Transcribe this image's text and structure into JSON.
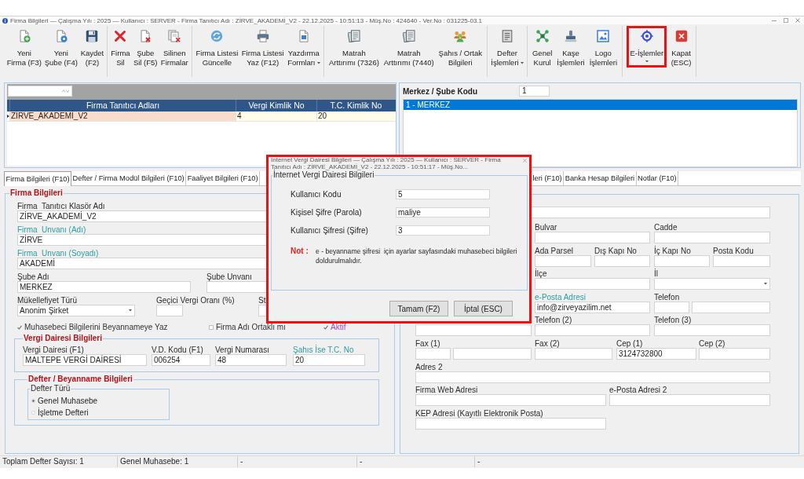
{
  "window": {
    "title": "Firma Bilgileri — Çalışma Yılı : 2025 — Kullanıcı : SERVER - Firma Tanıtıcı Adı : ZİRVE_AKADEMİ_V2 - 22.12.2025 - 10:51:13 - Müş.No : 424640 - Ver.No : 031225-03.1"
  },
  "toolbar": {
    "groups": [
      [
        {
          "kind": "new-firm",
          "label": "Yeni\nFirma (F3)",
          "dropdown": false,
          "highlighted": false
        },
        {
          "kind": "new-branch",
          "label": "Yeni\nŞube (F4)",
          "dropdown": false,
          "highlighted": false
        },
        {
          "kind": "save",
          "label": "Kaydet\n(F2)",
          "dropdown": false,
          "highlighted": false
        }
      ],
      [
        {
          "kind": "delete",
          "label": "Firma\nSil",
          "dropdown": false,
          "highlighted": false
        },
        {
          "kind": "delete-branch",
          "label": "Şube\nSil (F5)",
          "dropdown": false,
          "highlighted": false
        },
        {
          "kind": "deleted-list",
          "label": "Silinen\nFirmalar",
          "dropdown": false,
          "highlighted": false
        }
      ],
      [
        {
          "kind": "refresh",
          "label": "Firma Listesi\nGüncelle",
          "dropdown": false,
          "highlighted": false
        },
        {
          "kind": "print",
          "label": "Firma Listesi\nYaz (F12)",
          "dropdown": false,
          "highlighted": false
        },
        {
          "kind": "print-forms",
          "label": "Yazdırma\nFormları",
          "dropdown": true,
          "highlighted": false
        }
      ],
      [
        {
          "kind": "tax-base",
          "label": "Matrah\nArttırımı (7326)",
          "dropdown": false,
          "highlighted": false
        },
        {
          "kind": "tax-base",
          "label": "Matrah\nArttırımı (7440)",
          "dropdown": false,
          "highlighted": false
        },
        {
          "kind": "partners",
          "label": "Şahıs / Ortak\nBilgileri",
          "dropdown": false,
          "highlighted": false
        }
      ],
      [
        {
          "kind": "ledger",
          "label": "Defter\nİşlemleri",
          "dropdown": true,
          "highlighted": false
        }
      ],
      [
        {
          "kind": "assembly",
          "label": "Genel\nKurul",
          "dropdown": false,
          "highlighted": false
        },
        {
          "kind": "stamp",
          "label": "Kaşe\nİşlemleri",
          "dropdown": false,
          "highlighted": false
        },
        {
          "kind": "logo",
          "label": "Logo\nİşlemleri",
          "dropdown": false,
          "highlighted": false
        }
      ],
      [
        {
          "kind": "e-services",
          "label": "E-İşlemler",
          "dropdown": true,
          "highlighted": true
        },
        {
          "kind": "close",
          "label": "Kapat\n(ESC)",
          "dropdown": false,
          "highlighted": false
        }
      ]
    ]
  },
  "firm_grid": {
    "columns": [
      "Firma Tanıtıcı Adları",
      "Vergi Kimlik No",
      "T.C. Kimlik No"
    ],
    "rows": [
      {
        "cells": [
          "ZİRVE_AKADEMİ_V2",
          "4",
          "20"
        ],
        "selected": true
      }
    ]
  },
  "branches": {
    "label": "Merkez / Şube Kodu",
    "code": "1",
    "items": [
      {
        "text": "1 - MERKEZ",
        "selected": true
      }
    ]
  },
  "tabs": [
    {
      "label": "Firma Bilgileri (F10)",
      "selected": true
    },
    {
      "label": "Defter / Firma Modül Bilgileri (F10)",
      "selected": false
    },
    {
      "label": "Faaliyet Bilgileri (F10)",
      "selected": false
    },
    {
      "label": "leri (F10)",
      "selected": false
    },
    {
      "label": "Banka Hesap Bilgileri",
      "selected": false
    },
    {
      "label": "Notlar (F10)",
      "selected": false
    }
  ],
  "firm_info": {
    "legend": "Firma Bilgileri",
    "rows": [
      [
        {
          "kind": "text",
          "label": "Firma  Tanıtıcı Klasör Adı",
          "value": "ZİRVE_AKADEMİ_V2",
          "emphasized": false
        }
      ],
      [
        {
          "kind": "text",
          "label": "Firma  Unvanı (Adı)",
          "value": "ZİRVE",
          "emphasized": true
        }
      ],
      [
        {
          "kind": "text",
          "label": "Firma  Unvanı (Soyadı)",
          "value": "AKADEMİ",
          "emphasized": true
        }
      ],
      [
        {
          "kind": "text",
          "label": "Şube Adı",
          "value": "MERKEZ",
          "emphasized": false
        },
        {
          "kind": "text",
          "label": "Şube Unvanı",
          "emphasized": false
        }
      ],
      [
        {
          "kind": "select",
          "label": "Mükellefiyet Türü",
          "value": "Anonim Şirket",
          "emphasized": false
        },
        {
          "kind": "text",
          "label": "Geçici Vergi Oranı (%)",
          "emphasized": false
        },
        {
          "kind": "text",
          "label": "St",
          "emphasized": false
        }
      ]
    ],
    "checkboxes": [
      {
        "label": "Muhasebeci Bilgilerini Beyannameye Yaz",
        "checked": true,
        "emphasized": false
      },
      {
        "label": "Firma Adı Ortaklı mı",
        "checked": false,
        "emphasized": false
      },
      {
        "label": "Aktif",
        "checked": true,
        "emphasized": true
      }
    ],
    "tax_office": {
      "legend": "Vergi Dairesi Bilgileri",
      "fields": [
        {
          "kind": "text",
          "label": "Vergi Dairesi (F1)",
          "value": "MALTEPE VERGİ DAİRESİ",
          "emphasized": false
        },
        {
          "kind": "text",
          "label": "V.D. Kodu (F1)",
          "value": "006254",
          "emphasized": false
        },
        {
          "kind": "text",
          "label": "Vergi Numarası",
          "value": "48",
          "emphasized": false
        },
        {
          "kind": "text",
          "label": "Şahıs İse T.C. No",
          "value": "20",
          "emphasized": true
        }
      ]
    },
    "ledger": {
      "legend": "Defter / Beyanname Bilgileri",
      "type_legend": "Defter Türü",
      "options": [
        {
          "label": "Genel Muhasebe",
          "selected": true
        },
        {
          "label": "İşletme Defteri",
          "selected": false
        }
      ]
    }
  },
  "address": {
    "rows": [
      [
        {
          "kind": "text"
        }
      ],
      [
        {
          "kind": "text",
          "label": "Bulvar",
          "emphasized": false
        },
        {
          "kind": "text",
          "label": "Cadde",
          "emphasized": false
        }
      ],
      [
        {
          "kind": "text",
          "label": "Ada Parsel",
          "emphasized": false
        },
        {
          "kind": "text",
          "label": "Dış Kapı No",
          "emphasized": false
        },
        {
          "kind": "text",
          "label": "İç Kapı No",
          "emphasized": false
        },
        {
          "kind": "text",
          "label": "Posta Kodu",
          "emphasized": false
        }
      ],
      [
        {
          "kind": "text",
          "label": "İlçe",
          "emphasized": false
        },
        {
          "kind": "select",
          "label": "İl",
          "emphasized": false
        }
      ],
      [
        {
          "kind": "text",
          "label": "e-Posta Adresi",
          "value": "info@zirveyazilim.net",
          "emphasized": true
        },
        {
          "kind": "split",
          "label": "Telefon",
          "emphasized": false
        }
      ],
      [
        {
          "kind": "text"
        },
        {
          "kind": "text",
          "label": "Telefon (2)",
          "emphasized": false
        },
        {
          "kind": "text",
          "label": "Telefon (3)",
          "emphasized": false
        }
      ],
      [
        {
          "kind": "split",
          "label": "Fax (1)",
          "emphasized": false
        },
        {
          "kind": "text",
          "label": "Fax (2)",
          "emphasized": false
        },
        {
          "kind": "text",
          "label": "Cep (1)",
          "value": "3124732800",
          "emphasized": false
        },
        {
          "kind": "text",
          "label": "Cep (2)",
          "emphasized": false
        }
      ],
      [
        {
          "kind": "text",
          "label": "Adres 2",
          "emphasized": false
        }
      ],
      [
        {
          "kind": "text",
          "label": "Firma Web Adresi",
          "emphasized": false
        },
        {
          "kind": "text",
          "label": "e-Posta Adresi 2",
          "emphasized": false
        }
      ],
      [
        {
          "kind": "text",
          "label": "KEP Adresi (Kayıtlı Elektronik Posta)",
          "emphasized": false
        }
      ]
    ]
  },
  "status_bar": [
    "Toplam Defter Sayısı: 1",
    "Genel Muhasebe: 1",
    "-",
    "-",
    "-"
  ],
  "dialog": {
    "title": "İnternet Vergi Dairesi Bilgileri — Çalışma Yılı : 2025 — Kullanıcı : SERVER - Firma Tanıtıcı Adı : ZİRVE_AKADEMİ_V2 - 22.12.2025 - 10:51:17 - Müş.No...",
    "highlighted": true,
    "legend": "İnternet Vergi Dairesi Bilgileri",
    "fields": [
      {
        "label": "Kullanıcı Kodu",
        "value": "5"
      },
      {
        "label": "Kişisel Şifre (Parola)",
        "value": "maliye"
      },
      {
        "label": "Kullanıcı Şifresi (Şifre)",
        "value": "3"
      }
    ],
    "note_label": "Not :",
    "note": "e - beyanname şifresi  için ayarlar sayfasındaki muhasebeci bilgileri doldurulmalıdır.",
    "buttons": [
      "Tamam (F2)",
      "İptal (ESC)"
    ]
  }
}
